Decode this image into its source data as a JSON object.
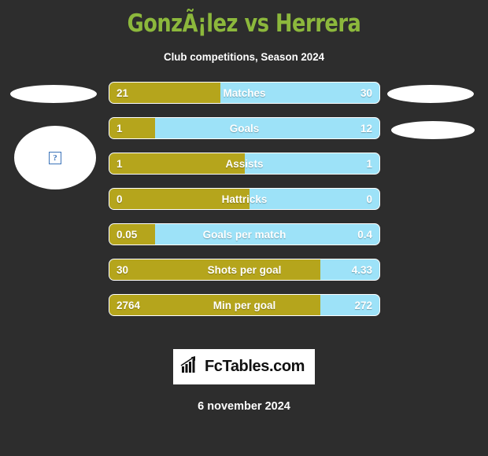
{
  "header": {
    "title": "GonzÃ¡lez vs Herrera",
    "subtitle": "Club competitions, Season 2024"
  },
  "colors": {
    "background": "#2d2d2d",
    "title_green": "#8cb83c",
    "home_gold": "#b5a51c",
    "away_blue": "#9de2f8",
    "text_white": "#ffffff",
    "logo_black": "#111111"
  },
  "players": {
    "home_avatar": "broken-image-placeholder",
    "away_avatar": "missing-image"
  },
  "chart_data": {
    "type": "bar",
    "title": "GonzÃ¡lez vs Herrera",
    "subtitle": "Club competitions, Season 2024",
    "orientation": "horizontal-diverging",
    "series": [
      {
        "name": "GonzÃ¡lez",
        "color": "#b5a51c",
        "side": "left"
      },
      {
        "name": "Herrera",
        "color": "#9de2f8",
        "side": "right"
      }
    ],
    "categories": [
      "Matches",
      "Goals",
      "Assists",
      "Hattricks",
      "Goals per match",
      "Shots per goal",
      "Min per goal"
    ],
    "rows": [
      {
        "label": "Matches",
        "home": "21",
        "away": "30",
        "home_pct": 41
      },
      {
        "label": "Goals",
        "home": "1",
        "away": "12",
        "home_pct": 17
      },
      {
        "label": "Assists",
        "home": "1",
        "away": "1",
        "home_pct": 50
      },
      {
        "label": "Hattricks",
        "home": "0",
        "away": "0",
        "home_pct": 52
      },
      {
        "label": "Goals per match",
        "home": "0.05",
        "away": "0.4",
        "home_pct": 17
      },
      {
        "label": "Shots per goal",
        "home": "30",
        "away": "4.33",
        "home_pct": 78
      },
      {
        "label": "Min per goal",
        "home": "2764",
        "away": "272",
        "home_pct": 78
      }
    ]
  },
  "footer": {
    "logo_icon": "bar-chart-arrow-icon",
    "logo_text": "FcTables.com",
    "date": "6 november 2024"
  }
}
